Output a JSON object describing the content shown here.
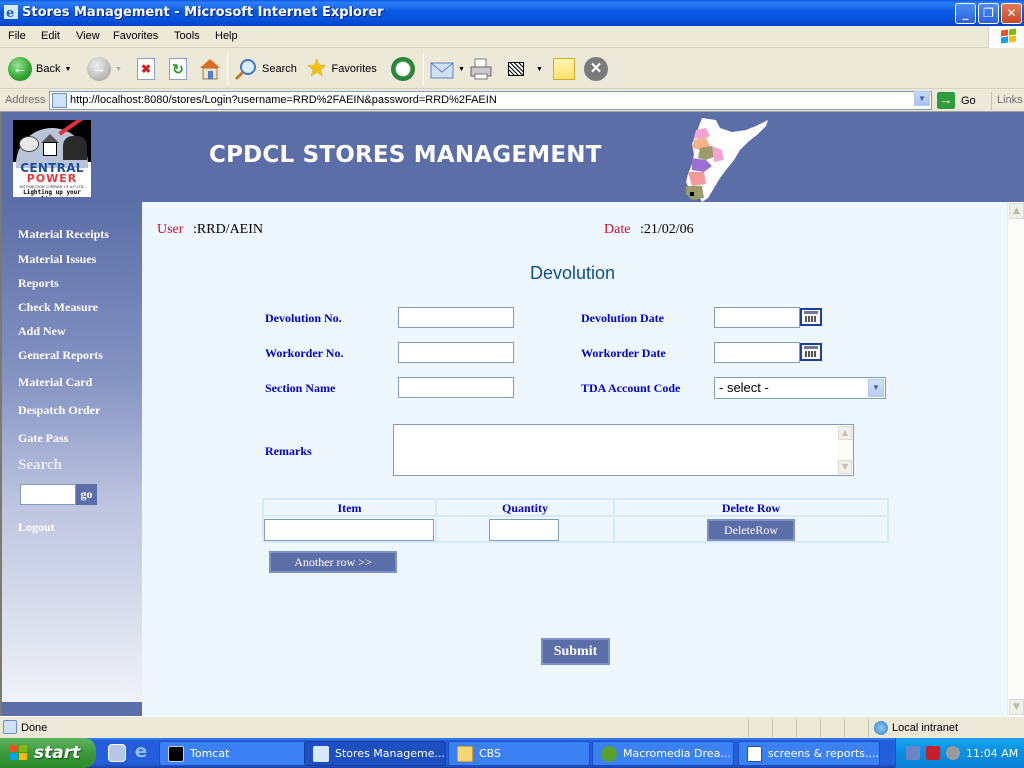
{
  "window": {
    "title": "Stores Management - Microsoft Internet Explorer",
    "controls": {
      "minimize": "_",
      "maximize": "❐",
      "close": "✕"
    }
  },
  "menu": [
    "File",
    "Edit",
    "View",
    "Favorites",
    "Tools",
    "Help"
  ],
  "toolbar": {
    "back_label": "Back",
    "search_label": "Search",
    "favorites_label": "Favorites",
    "icons": [
      "back-icon",
      "forward-icon",
      "stop-icon",
      "refresh-icon",
      "home-icon",
      "search-icon",
      "favorites-icon",
      "history-icon",
      "mail-icon",
      "print-icon",
      "edit-icon",
      "notes-icon",
      "messenger-icon"
    ]
  },
  "address": {
    "label": "Address",
    "url": "http://localhost:8080/stores/Login?username=RRD%2FAEIN&password=RRD%2FAEIN",
    "go_label": "Go",
    "links_label": "Links"
  },
  "page": {
    "logo": {
      "line1": "CENTRAL",
      "line2": "POWER",
      "line3": "DISTRIBUTION COMPANY OF A.P. LTD.",
      "tagline": "Lighting up your lives!"
    },
    "app_title": "CPDCL STORES MANAGEMENT",
    "sidebar": {
      "items": [
        {
          "label": "Material Receipts"
        },
        {
          "label": "Material Issues"
        },
        {
          "label": "Reports"
        },
        {
          "label": "Check Measure"
        },
        {
          "label": "Add New"
        },
        {
          "label": "General Reports"
        },
        {
          "label": "Material Card"
        },
        {
          "label": "Despatch Order"
        },
        {
          "label": "Gate Pass"
        }
      ],
      "search_label": "Search",
      "search_value": "",
      "go_label": "go",
      "logout_label": "Logout"
    },
    "user_label": "User",
    "user_value": ":RRD/AEIN",
    "date_label": "Date",
    "date_value": ":21/02/06",
    "form_title": "Devolution",
    "fields": {
      "devolution_no": {
        "label": "Devolution No.",
        "value": ""
      },
      "devolution_date": {
        "label": "Devolution Date",
        "value": ""
      },
      "workorder_no": {
        "label": "Workorder No.",
        "value": ""
      },
      "workorder_date": {
        "label": "Workorder Date",
        "value": ""
      },
      "section_name": {
        "label": "Section Name",
        "value": ""
      },
      "tda_account_code": {
        "label": "TDA Account Code",
        "selected": "- select -"
      },
      "remarks": {
        "label": "Remarks",
        "value": ""
      }
    },
    "items_table": {
      "headers": [
        "Item",
        "Quantity",
        "Delete Row"
      ],
      "rows": [
        {
          "item": "",
          "quantity": "",
          "delete_label": "DeleteRow"
        }
      ]
    },
    "another_row_label": "Another row >>",
    "submit_label": "Submit"
  },
  "statusbar": {
    "status": "Done",
    "zone": "Local intranet"
  },
  "taskbar": {
    "start_label": "start",
    "tasks": [
      {
        "label": "Tomcat",
        "icon": "console-icon"
      },
      {
        "label": "Stores Manageme...",
        "icon": "ie-icon",
        "active": true
      },
      {
        "label": "CBS",
        "icon": "folder-icon"
      },
      {
        "label": "Macromedia Drea...",
        "icon": "dreamweaver-icon"
      },
      {
        "label": "screens & reports....",
        "icon": "word-icon"
      }
    ],
    "clock": "11:04 AM"
  },
  "colors": {
    "header_bg": "#5c6ea8",
    "content_bg": "#eff7fe",
    "label_blue": "#0000cc",
    "label_red": "#c8102e",
    "title_teal": "#0d4f8a"
  }
}
